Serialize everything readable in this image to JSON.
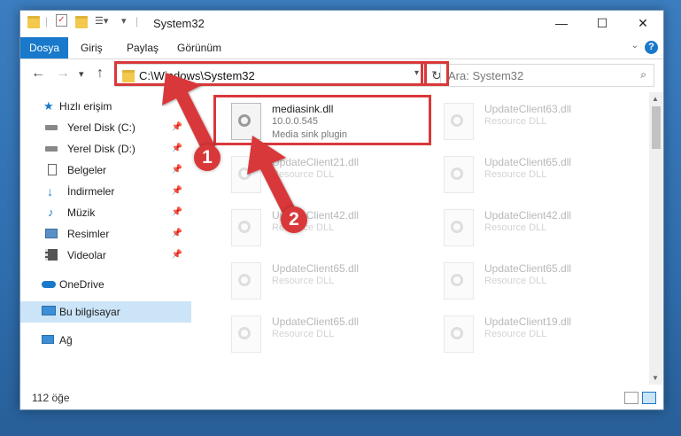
{
  "window": {
    "title": "System32",
    "controls": {
      "minimize": "—",
      "maximize": "☐",
      "close": "✕"
    }
  },
  "ribbon": {
    "tabs": [
      "Dosya",
      "Giriş",
      "Paylaş",
      "Görünüm"
    ],
    "active_tab": "Dosya",
    "help": "?"
  },
  "navigation": {
    "back": "←",
    "forward": "→",
    "recent": "▾",
    "up": "↑",
    "address": "C:\\Windows\\System32",
    "refresh": "↻",
    "search_placeholder": "Ara: System32"
  },
  "sidebar": {
    "items": [
      {
        "label": "Hızlı erişim",
        "icon": "star-icon",
        "pinned": false,
        "selected": false
      },
      {
        "label": "Yerel Disk (C:)",
        "icon": "drive-icon",
        "pinned": true,
        "selected": false
      },
      {
        "label": "Yerel Disk (D:)",
        "icon": "drive-icon",
        "pinned": true,
        "selected": false
      },
      {
        "label": "Belgeler",
        "icon": "document-icon",
        "pinned": true,
        "selected": false
      },
      {
        "label": "İndirmeler",
        "icon": "download-icon",
        "pinned": true,
        "selected": false
      },
      {
        "label": "Müzik",
        "icon": "music-icon",
        "pinned": true,
        "selected": false
      },
      {
        "label": "Resimler",
        "icon": "pictures-icon",
        "pinned": true,
        "selected": false
      },
      {
        "label": "Videolar",
        "icon": "video-icon",
        "pinned": true,
        "selected": false
      },
      {
        "label": "OneDrive",
        "icon": "cloud-icon",
        "pinned": false,
        "selected": false
      },
      {
        "label": "Bu bilgisayar",
        "icon": "computer-icon",
        "pinned": false,
        "selected": true
      },
      {
        "label": "Ağ",
        "icon": "network-icon",
        "pinned": false,
        "selected": false
      }
    ]
  },
  "files": [
    {
      "name": "mediasink.dll",
      "line2": "10.0.0.545",
      "line3": "Media sink plugin",
      "highlighted": true
    },
    {
      "name": "UpdateClient63.dll",
      "line2": "Resource DLL",
      "line3": "",
      "highlighted": false
    },
    {
      "name": "UpdateClient21.dll",
      "line2": "Resource DLL",
      "line3": "",
      "highlighted": false
    },
    {
      "name": "UpdateClient65.dll",
      "line2": "Resource DLL",
      "line3": "",
      "highlighted": false
    },
    {
      "name": "UpdateClient42.dll",
      "line2": "Resource DLL",
      "line3": "",
      "highlighted": false
    },
    {
      "name": "UpdateClient42.dll",
      "line2": "Resource DLL",
      "line3": "",
      "highlighted": false
    },
    {
      "name": "UpdateClient65.dll",
      "line2": "Resource DLL",
      "line3": "",
      "highlighted": false
    },
    {
      "name": "UpdateClient65.dll",
      "line2": "Resource DLL",
      "line3": "",
      "highlighted": false
    },
    {
      "name": "UpdateClient65.dll",
      "line2": "Resource DLL",
      "line3": "",
      "highlighted": false
    },
    {
      "name": "UpdateClient19.dll",
      "line2": "Resource DLL",
      "line3": "",
      "highlighted": false
    }
  ],
  "status": {
    "item_count": "112 öğe"
  },
  "annotations": {
    "step1": "1",
    "step2": "2",
    "color": "#d9383a"
  },
  "colors": {
    "accent": "#1979ca",
    "selection": "#cce4f7",
    "desktop": "#2f6eae"
  }
}
